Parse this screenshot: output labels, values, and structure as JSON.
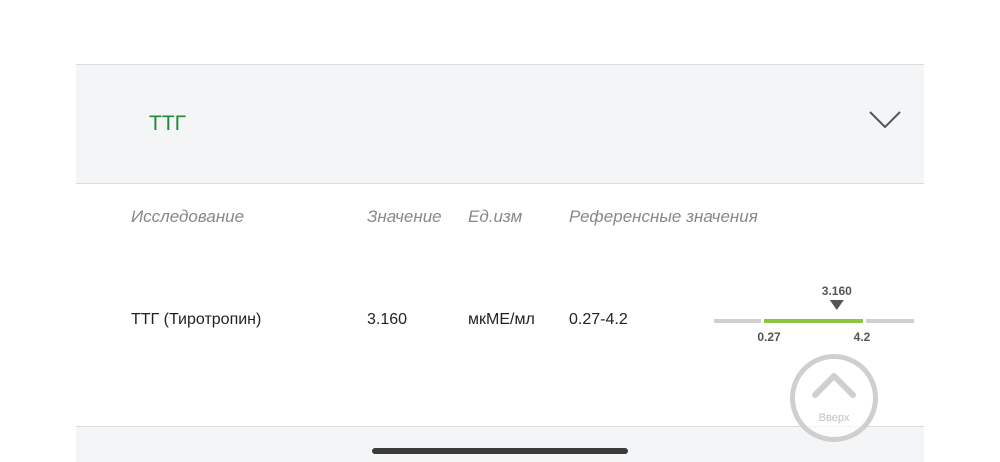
{
  "section": {
    "title": "ТТГ",
    "toggle_icon": "chevron-down-icon"
  },
  "table": {
    "headers": [
      "Исследование",
      "Значение",
      "Ед.изм",
      "Референсные значения"
    ],
    "rows": [
      {
        "name": "ТТГ (Тиротропин)",
        "value": "3.160",
        "unit": "мкМЕ/мл",
        "reference": "0.27-4.2",
        "range": {
          "min_label": "0.27",
          "max_label": "4.2",
          "value_label": "3.160",
          "min": 0.27,
          "max": 4.2,
          "value": 3.16,
          "in_range_color": "#8cc63f",
          "out_range_color": "#cfcfcf",
          "marker_color": "#555555"
        }
      }
    ]
  },
  "scroll_top": {
    "label": "Вверх",
    "icon": "chevron-up-icon"
  }
}
